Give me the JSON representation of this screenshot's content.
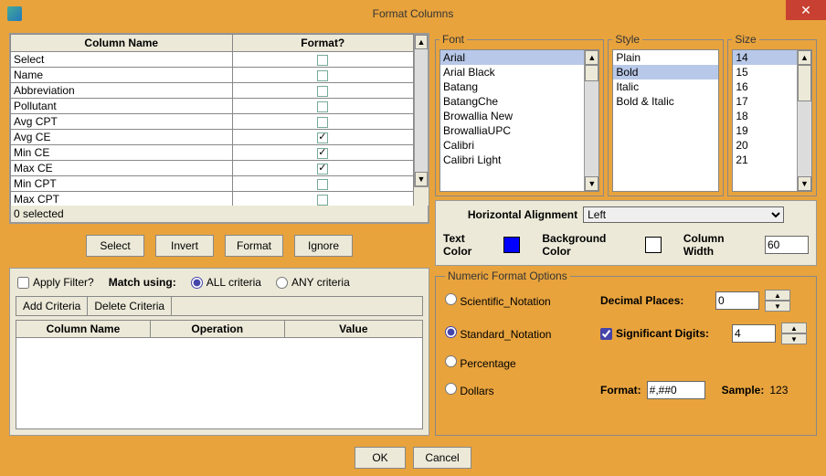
{
  "window": {
    "title": "Format Columns"
  },
  "columns_table": {
    "headers": [
      "Column Name",
      "Format?"
    ],
    "rows": [
      {
        "name": "Select",
        "checked": false
      },
      {
        "name": "Name",
        "checked": false
      },
      {
        "name": "Abbreviation",
        "checked": false
      },
      {
        "name": "Pollutant",
        "checked": false
      },
      {
        "name": "Avg CPT",
        "checked": false
      },
      {
        "name": "Avg CE",
        "checked": true
      },
      {
        "name": "Min CE",
        "checked": true
      },
      {
        "name": "Max CE",
        "checked": true
      },
      {
        "name": "Min CPT",
        "checked": false
      },
      {
        "name": "Max CPT",
        "checked": false
      }
    ],
    "status": "0 selected"
  },
  "buttons": {
    "select": "Select",
    "invert": "Invert",
    "format": "Format",
    "ignore": "Ignore"
  },
  "filter": {
    "apply_label": "Apply Filter?",
    "match_label": "Match using:",
    "all_label": "ALL criteria",
    "any_label": "ANY criteria",
    "add": "Add Criteria",
    "delete": "Delete Criteria",
    "headers": [
      "Column Name",
      "Operation",
      "Value"
    ]
  },
  "font": {
    "legend": "Font",
    "items": [
      "Arial",
      "Arial Black",
      "Batang",
      "BatangChe",
      "Browallia New",
      "BrowalliaUPC",
      "Calibri",
      "Calibri Light"
    ],
    "selected": "Arial"
  },
  "style": {
    "legend": "Style",
    "items": [
      "Plain",
      "Bold",
      "Italic",
      "Bold & Italic"
    ],
    "selected": "Bold"
  },
  "size": {
    "legend": "Size",
    "items": [
      "14",
      "15",
      "16",
      "17",
      "18",
      "19",
      "20",
      "21"
    ],
    "selected": "14"
  },
  "alignment": {
    "label": "Horizontal Alignment",
    "value": "Left"
  },
  "colors": {
    "text_label": "Text Color",
    "bg_label": "Background Color",
    "colwidth_label": "Column Width",
    "colwidth_value": "60"
  },
  "numeric": {
    "legend": "Numeric Format Options",
    "scientific": "Scientific_Notation",
    "standard": "Standard_Notation",
    "percentage": "Percentage",
    "dollars": "Dollars",
    "decimal_label": "Decimal Places:",
    "decimal_value": "0",
    "sigdig_label": "Significant Digits:",
    "sigdig_value": "4",
    "sigdig_checked": true,
    "format_label": "Format:",
    "format_value": "#,##0",
    "sample_label": "Sample:",
    "sample_value": "123",
    "selected": "standard"
  },
  "bottom": {
    "ok": "OK",
    "cancel": "Cancel"
  }
}
